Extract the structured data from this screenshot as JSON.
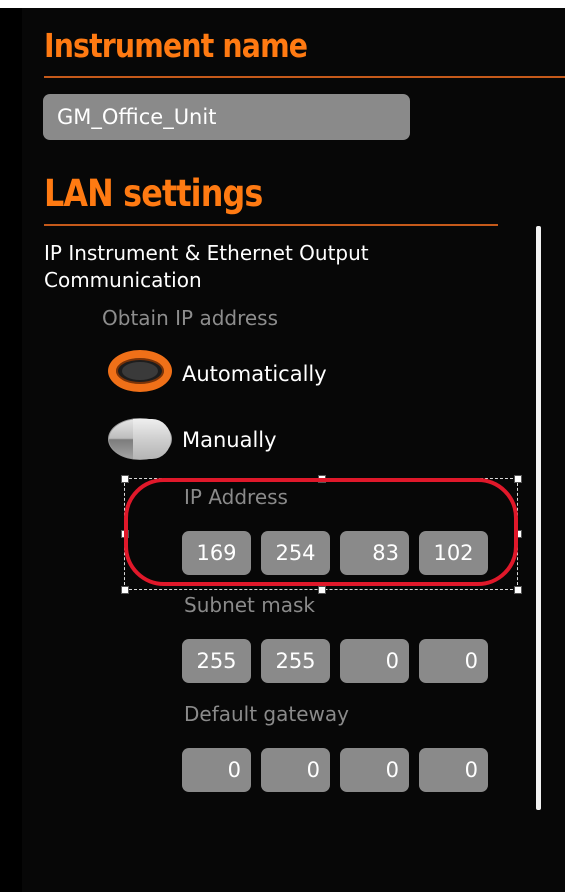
{
  "instrument": {
    "heading": "Instrument name",
    "name_value": "GM_Office_Unit"
  },
  "lan": {
    "heading": "LAN settings",
    "section_line1": "IP Instrument & Ethernet Output",
    "section_line2": "Communication",
    "obtain_label": "Obtain IP address",
    "options": {
      "automatic": "Automatically",
      "manual": "Manually",
      "selected": "automatic"
    },
    "ip_address": {
      "label": "IP Address",
      "octets": [
        "169",
        "254",
        "83",
        "102"
      ]
    },
    "subnet_mask": {
      "label": "Subnet mask",
      "octets": [
        "255",
        "255",
        "0",
        "0"
      ]
    },
    "default_gateway": {
      "label": "Default gateway",
      "octets": [
        "0",
        "0",
        "0",
        "0"
      ]
    }
  },
  "colors": {
    "heading_orange": "#ff7a12",
    "field_gray": "#8a8a8a",
    "highlight_red": "#e0182a",
    "background": "#070707"
  },
  "icons": {
    "radio_selected": "radio-selected-icon",
    "radio_unselected": "radio-unselected-icon"
  }
}
